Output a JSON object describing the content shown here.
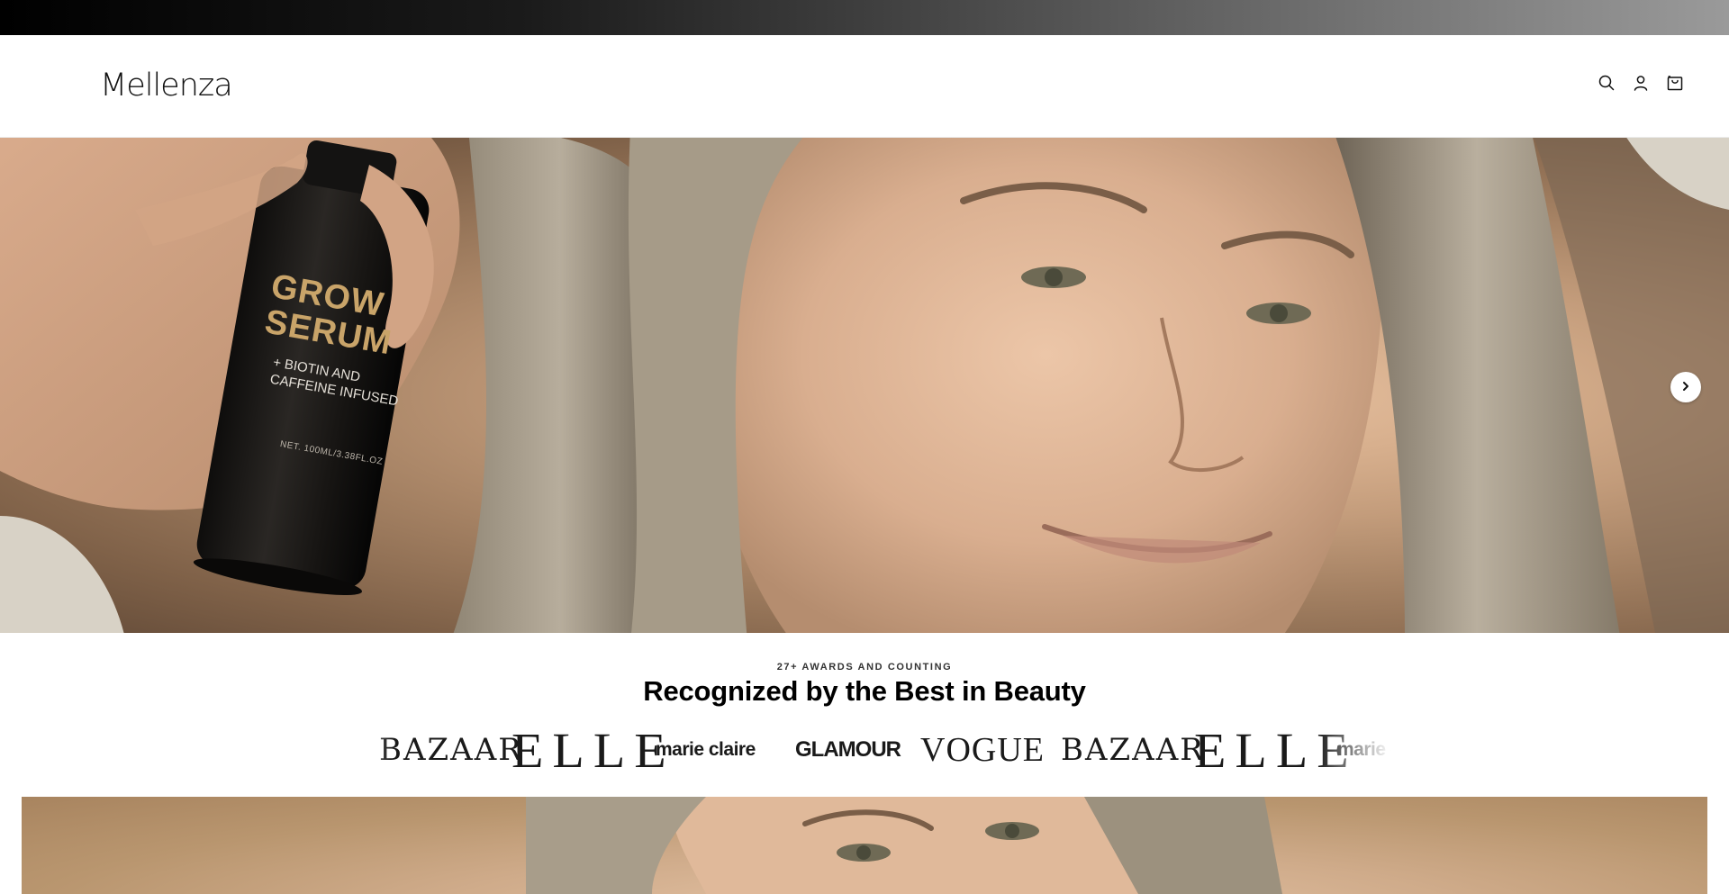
{
  "brand": {
    "logo_text": "Mellenza"
  },
  "header": {
    "icons": [
      "search-icon",
      "account-icon",
      "cart-icon"
    ]
  },
  "hero": {
    "bottle_label_line1": "GROW",
    "bottle_label_line2": "SERUM",
    "bottle_subtext_line1": "+ BIOTIN AND",
    "bottle_subtext_line2": "CAFFEINE INFUSED",
    "bottle_net": "NET. 100ML/3.38FL.OZ",
    "next_icon": "chevron-right-icon"
  },
  "awards": {
    "eyebrow": "27+ AWARDS AND COUNTING",
    "title": "Recognized by the Best in Beauty",
    "press_logos": [
      "BAZAAR",
      "ELLE",
      "marie claire",
      "GLAMOUR",
      "VOGUE",
      "BAZAAR",
      "ELLE",
      "marie claire"
    ]
  },
  "colors": {
    "announcement_bar_start": "#000000",
    "announcement_bar_end": "#9a9a9a",
    "hero_background": "#c39c7b",
    "bottle_label_gold": "#c9a469"
  }
}
